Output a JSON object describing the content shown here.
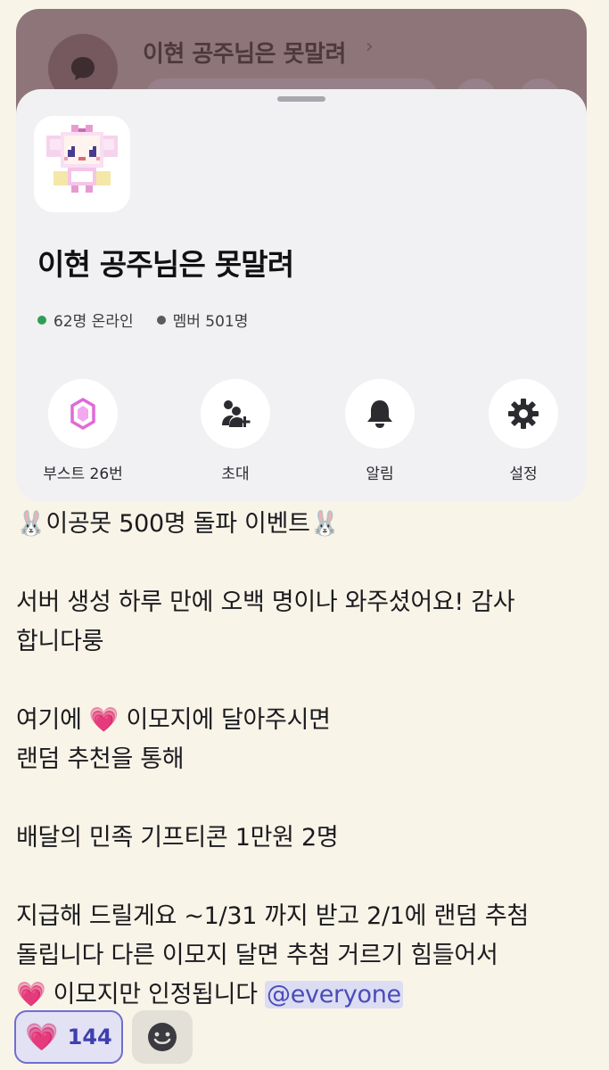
{
  "backdrop": {
    "server_title": "이현 공주님은 못말려",
    "chevron": "›"
  },
  "sheet": {
    "server_name": "이현 공주님은 못말려",
    "online": "62명 온라인",
    "members": "멤버 501명",
    "actions": [
      {
        "label": "부스트 26번",
        "icon": "boost-gem-icon"
      },
      {
        "label": "초대",
        "icon": "add-person-icon"
      },
      {
        "label": "알림",
        "icon": "bell-icon"
      },
      {
        "label": "설정",
        "icon": "gear-icon"
      }
    ]
  },
  "message": {
    "line1_emoji": "🐰",
    "line1_text": "이공못  500명 돌파 이벤트",
    "line1_emoji_end": "🐰",
    "line2": "서버 생성 하루 만에 오백 명이나 와주셨어요! 감사",
    "line3": "합니다룽",
    "line4_pre": "여기에 ",
    "line4_emoji": "💗",
    "line4_post": " 이모지에 달아주시면",
    "line5": "랜덤 추천을 통해",
    "line6": "배달의 민족 기프티콘 1만원 2명",
    "line7": "지급해 드릴게요 ~1/31 까지 받고 2/1에 랜덤 추첨",
    "line8": "돌립니다 다른 이모지 달면 추첨 거르기 힘들어서",
    "line9_emoji": "💗",
    "line9_text": " 이모지만 인정됩니다 ",
    "mention": "@everyone"
  },
  "reactions": {
    "heart_emoji": "💗",
    "heart_count": "144"
  }
}
